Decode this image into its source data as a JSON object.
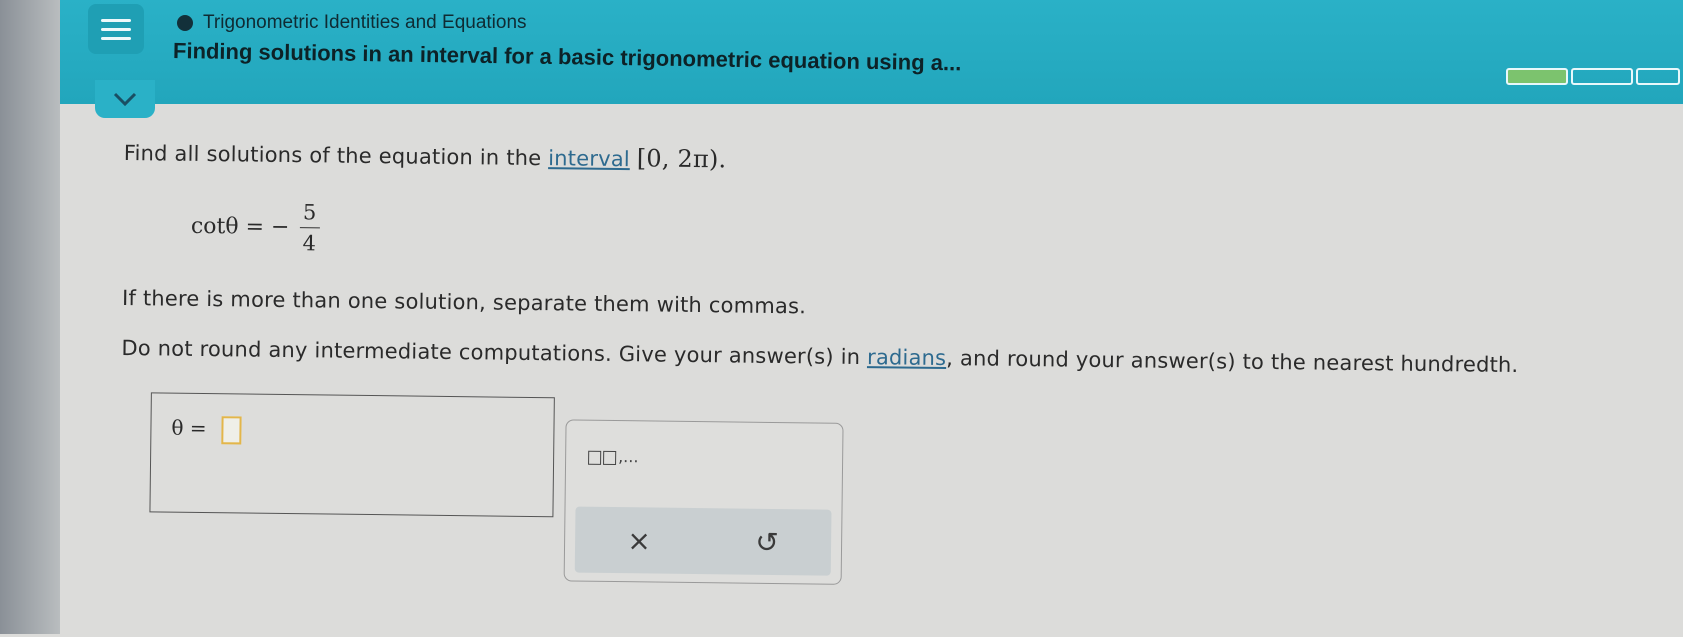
{
  "header": {
    "topic": "Trigonometric Identities and Equations",
    "title": "Finding solutions in an interval for a basic trigonometric equation using a...",
    "progress": [
      1,
      0,
      0
    ]
  },
  "question": {
    "intro_text": "Find all solutions of the equation in the ",
    "interval_link": "interval",
    "interval_math": "[0, 2π).",
    "equation_lhs": "cotθ = −",
    "fraction_num": "5",
    "fraction_den": "4",
    "instruction1": "If there is more than one solution, separate them with commas.",
    "instruction2_a": "Do not round any intermediate computations. Give your answer(s) in ",
    "instruction2_link": "radians",
    "instruction2_b": ", and round your answer(s) to the nearest hundredth."
  },
  "answer": {
    "label": "θ =",
    "value": ""
  },
  "tools": {
    "symbol_suffix": ",...",
    "clear_label": "×",
    "undo_label": "↺"
  }
}
